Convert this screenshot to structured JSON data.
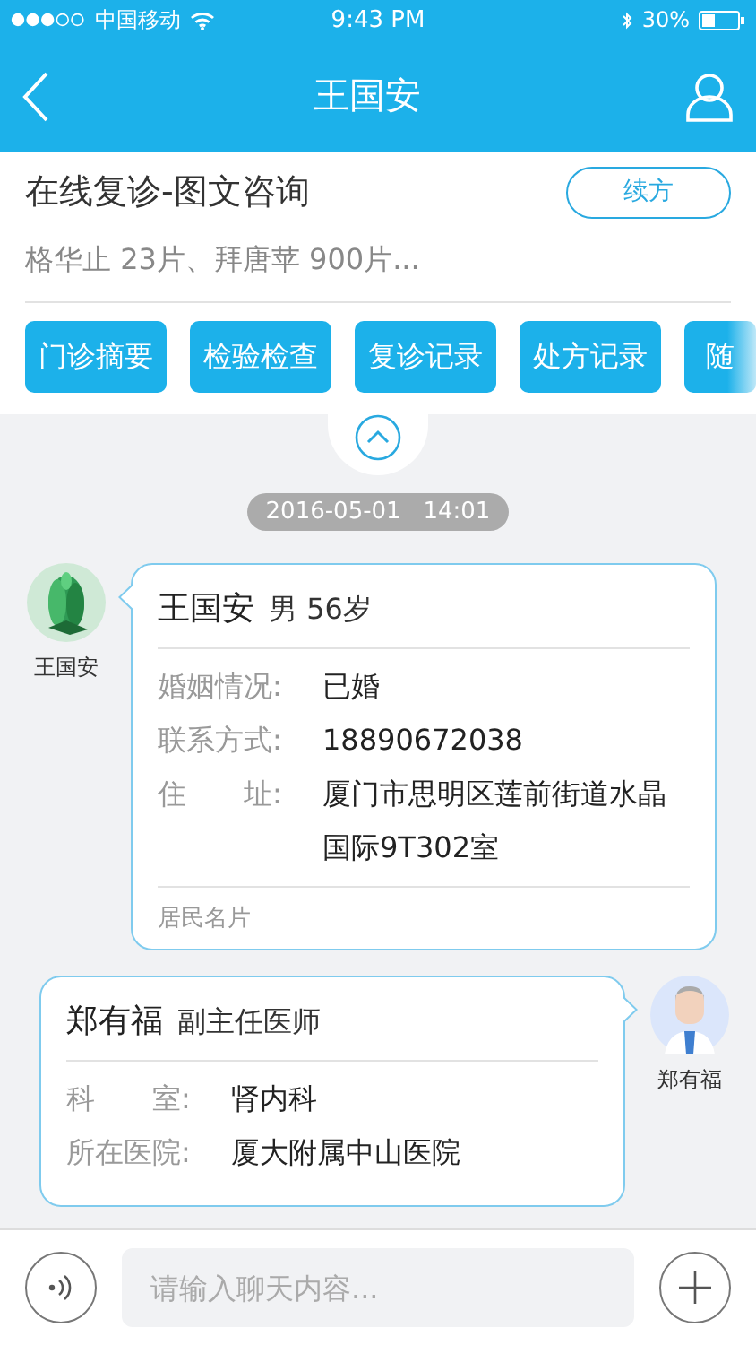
{
  "status_bar": {
    "carrier": "中国移动",
    "time": "9:43 PM",
    "battery": "30%"
  },
  "nav": {
    "title": "王国安"
  },
  "consult": {
    "title": "在线复诊-图文咨询",
    "renew_button": "续方",
    "drugs": "格华止 23片、拜唐苹 900片...",
    "actions": [
      {
        "label": "门诊摘要"
      },
      {
        "label": "检验检查"
      },
      {
        "label": "复诊记录"
      },
      {
        "label": "处方记录"
      },
      {
        "label": "随"
      }
    ]
  },
  "chat": {
    "date": "2016-05-01   14:01",
    "messages": [
      {
        "kind": "patient_card",
        "sender": "王国安",
        "name": "王国安",
        "info": "男 56岁",
        "fields": [
          {
            "label": "婚姻情况:",
            "value": "已婚"
          },
          {
            "label": "联系方式:",
            "value": "18890672038"
          },
          {
            "label": "住　　址:",
            "value": "厦门市思明区莲前街道水晶国际9T302室"
          }
        ],
        "footer": "居民名片"
      },
      {
        "kind": "doctor_card",
        "sender": "郑有福",
        "name": "郑有福",
        "info": "副主任医师",
        "fields": [
          {
            "label": "科　　室:",
            "value": "肾内科"
          },
          {
            "label": "所在医院:",
            "value": "厦大附属中山医院"
          }
        ]
      }
    ]
  },
  "input": {
    "placeholder": "请输入聊天内容..."
  }
}
